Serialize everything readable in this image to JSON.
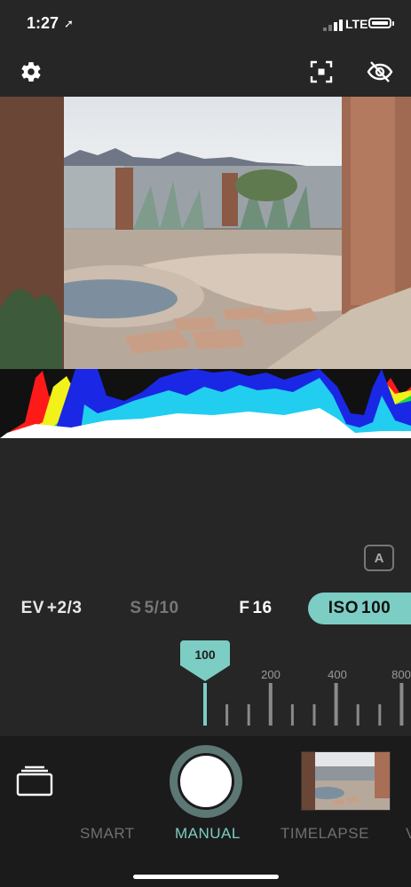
{
  "status_bar": {
    "time": "1:27",
    "location_icon": "location-arrow-icon",
    "network": "LTE",
    "signal_icon": "cellular-signal-icon",
    "battery_icon": "battery-icon"
  },
  "toolbar": {
    "settings_icon": "gear-icon",
    "focus_icon": "focus-frame-icon",
    "hide_icon": "eye-slash-icon"
  },
  "auto_button": {
    "label": "A"
  },
  "exposure": {
    "ev": {
      "key": "EV",
      "value": "+2/3"
    },
    "shutter": {
      "key": "S",
      "value": "5/10"
    },
    "aperture": {
      "key": "F",
      "value": "16"
    },
    "iso": {
      "key": "ISO",
      "value": "100"
    }
  },
  "iso_dial": {
    "selected": "100",
    "labels": [
      "200",
      "400",
      "800"
    ]
  },
  "modes": {
    "smart": "SMART",
    "manual": "MANUAL",
    "timelapse": "TIMELAPSE",
    "more": "V",
    "active": "MANUAL"
  },
  "colors": {
    "accent": "#7ccdc3",
    "background": "#262626",
    "bottom_bar": "#1b1b1b"
  }
}
